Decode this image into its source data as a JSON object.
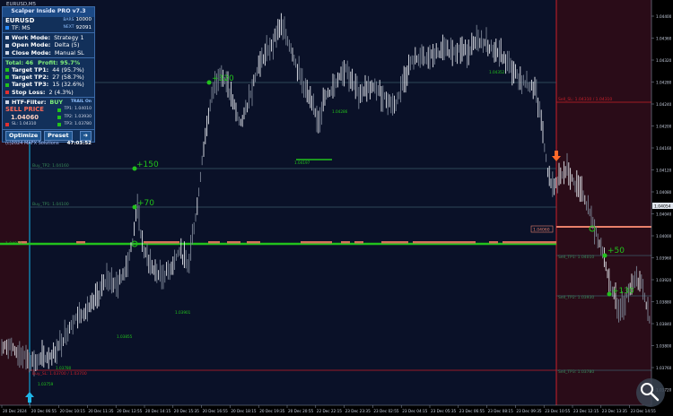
{
  "window": {
    "title": "EURUSD,M5"
  },
  "panel": {
    "title": "Scalper Inside PRO v7.3",
    "symbol": "EURUSD",
    "bars_label": "BARS",
    "bars_value": "10000",
    "tf": "TF: M5",
    "next_label": "NEXT",
    "next_value": "92091",
    "work_mode_k": "Work Mode:",
    "work_mode_v": "Strategy 1",
    "open_mode_k": "Open Mode:",
    "open_mode_v": "Delta (5)",
    "close_mode_k": "Close Mode:",
    "close_mode_v": "Manual SL",
    "total": "Total: 46",
    "profit": "Profit: 95.7%",
    "tp1_k": "Target TP1:",
    "tp1_v": "44 (95.7%)",
    "tp2_k": "Target TP2:",
    "tp2_v": "27 (58.7%)",
    "tp3_k": "Target TP3:",
    "tp3_v": "15 (32.6%)",
    "sl_k": "Stop Loss:",
    "sl_v": "2 (4.3%)",
    "htf_k": "HTF-Filter:",
    "htf_v": "BUY",
    "trail": "TRAIL On",
    "sell_price_label": "SELL PRICE",
    "sell_price_value": "1.04060",
    "sl_line": "SL: 1.04310",
    "tp1_line": "TP1: 1.04010",
    "tp2_line": "TP2: 1.03930",
    "tp3_line": "TP3: 1.03780",
    "optimize": "Optimize",
    "preset": "Preset",
    "copyright": "(c)2024 MAFX Solutions",
    "clock": "47:03:52"
  },
  "price_axis": [
    "1.04400",
    "1.04360",
    "1.04320",
    "1.04280",
    "1.04240",
    "1.04200",
    "1.04160",
    "1.04120",
    "1.04080",
    "1.04040",
    "1.04000",
    "1.03960",
    "1.03920",
    "1.03880",
    "1.03840",
    "1.03800",
    "1.03760",
    "1.03720"
  ],
  "current_price_tag": "1.04054",
  "time_axis": [
    "20 Dec 2024",
    "20 Dec 06:55",
    "20 Dec 10:15",
    "20 Dec 11:35",
    "20 Dec 12:55",
    "20 Dec 14:15",
    "20 Dec 15:35",
    "20 Dec 16:55",
    "20 Dec 18:15",
    "20 Dec 19:35",
    "20 Dec 20:55",
    "22 Dec 22:15",
    "23 Dec 23:35",
    "23 Dec 02:55",
    "23 Dec 04:15",
    "23 Dec 05:35",
    "23 Dec 06:55",
    "23 Dec 08:15",
    "23 Dec 09:35",
    "23 Dec 10:55",
    "23 Dec 12:15",
    "23 Dec 13:35",
    "23 Dec 14:55"
  ],
  "chart_labels": {
    "tp2_left": "Buy_TP2: 1.04160",
    "tp1_left": "Buy_TP1: 1.04100",
    "entry_left": "1.04032",
    "sl_left": "Buy_SL: 1.03700 / 1.03700",
    "sl_right": "Sell_SL: 1.04310 / 1.04310",
    "tp1_right": "Sell_TP1: 1.04010",
    "tp2_right": "Sell_TP2: 1.03930",
    "tp3_right": "Sell_TP3: 1.03780",
    "entry_right": "1.04060",
    "plus320": "+320",
    "plus150": "+150",
    "plus70": "+70",
    "plus50": "+50",
    "plus130": "+130",
    "lvl1": "1.04197",
    "lvl2": "1.04286",
    "lvl3": "1.04352",
    "lvl4": "1.03901",
    "lvl5": "1.03855",
    "lvl6": "1.03780",
    "lvl7": "1.03759"
  },
  "colors": {
    "bg": "#0a1128",
    "green": "#22c21c",
    "red": "#c8202a",
    "salmon": "#d7705a",
    "gray": "#4a6878",
    "cyan": "#1fb6e8",
    "orange": "#ff6a2a"
  }
}
